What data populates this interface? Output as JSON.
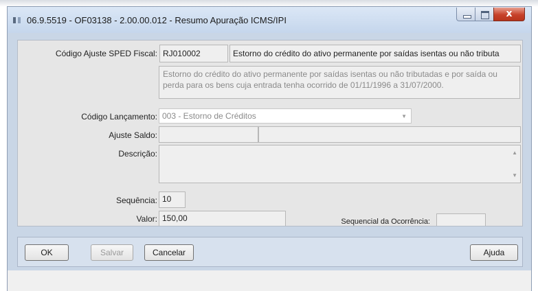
{
  "window": {
    "title": "06.9.5519 - OF03138 - 2.00.00.012 - Resumo Apuração ICMS/IPI",
    "close_glyph": "x"
  },
  "form": {
    "codigo_ajuste": {
      "label": "Código Ajuste SPED Fiscal:",
      "code": "RJ010002",
      "short_desc": "Estorno do crédito do ativo permanente por saídas isentas ou não tributa",
      "long_desc": "Estorno do crédito do ativo permanente por saídas isentas ou não tributadas e por saída ou perda para os bens cuja entrada tenha ocorrido de 01/11/1996 a 31/07/2000."
    },
    "codigo_lancamento": {
      "label": "Código Lançamento:",
      "value": "003 - Estorno de Créditos"
    },
    "ajuste_saldo": {
      "label": "Ajuste Saldo:",
      "code": "",
      "desc": ""
    },
    "descricao": {
      "label": "Descrição:",
      "value": ""
    },
    "sequencia": {
      "label": "Sequência:",
      "value": "10"
    },
    "valor": {
      "label": "Valor:",
      "value": "150,00"
    },
    "sequencial_ocorrencia": {
      "label": "Sequencial da Ocorrência:",
      "value": ""
    }
  },
  "buttons": {
    "ok": "OK",
    "salvar": "Salvar",
    "cancelar": "Cancelar",
    "ajuda": "Ajuda"
  },
  "icons": {
    "dropdown": "chevron-down-icon",
    "scroll_up": "scroll-up-icon",
    "scroll_down": "scroll-down-icon"
  }
}
